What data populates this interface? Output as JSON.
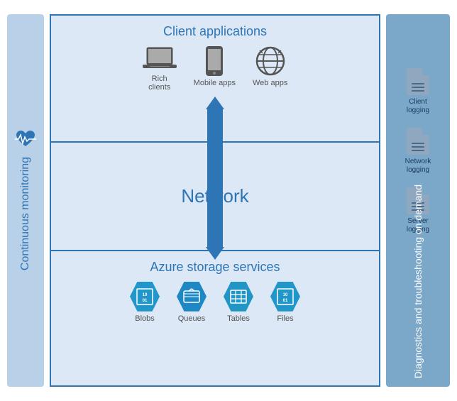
{
  "left_bar": {
    "label": "Continuous monitoring"
  },
  "right_bar": {
    "label_line1": "Diagnostics and troubleshooting",
    "label_line2": "on demand",
    "items": [
      {
        "label": "Client\nlogging"
      },
      {
        "label": "Network\nlogging"
      },
      {
        "label": "Server\nlogging"
      }
    ]
  },
  "sections": {
    "client": {
      "title": "Client applications",
      "icons": [
        {
          "label": "Rich\nclients",
          "type": "laptop"
        },
        {
          "label": "Mobile apps",
          "type": "mobile"
        },
        {
          "label": "Web apps",
          "type": "globe"
        }
      ]
    },
    "network": {
      "title": "Network"
    },
    "storage": {
      "title": "Azure storage services",
      "icons": [
        {
          "label": "Blobs",
          "type": "blobs",
          "text": "10\n01"
        },
        {
          "label": "Queues",
          "type": "queues",
          "text": "✉"
        },
        {
          "label": "Tables",
          "type": "tables",
          "text": "⊞"
        },
        {
          "label": "Files",
          "type": "files",
          "text": "10\n01"
        }
      ]
    }
  }
}
